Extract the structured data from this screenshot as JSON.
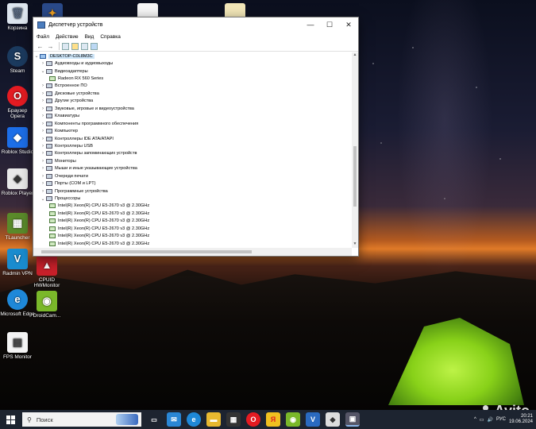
{
  "desktop": {
    "icons": [
      {
        "label": "Корзина",
        "icon": "recycle-bin-icon"
      },
      {
        "label": "Steam",
        "icon": "steam-icon"
      },
      {
        "label": "Браузер Opera",
        "icon": "opera-icon"
      },
      {
        "label": "Roblox Studio",
        "icon": "roblox-studio-icon"
      },
      {
        "label": "Roblox Player",
        "icon": "roblox-player-icon"
      },
      {
        "label": "TLauncher",
        "icon": "tlauncher-icon"
      },
      {
        "label": "Radmin VPN",
        "icon": "radmin-vpn-icon"
      },
      {
        "label": "Microsoft Edge",
        "icon": "edge-icon"
      },
      {
        "label": "FPS Monitor",
        "icon": "fps-monitor-icon"
      },
      {
        "label": "CPUID HWMonitor",
        "icon": "hwmonitor-icon"
      },
      {
        "label": "DroidCam...",
        "icon": "droidcam-icon"
      }
    ]
  },
  "window": {
    "title": "Диспетчер устройств",
    "controls": {
      "minimize": "—",
      "maximize": "☐",
      "close": "✕"
    },
    "menu": [
      "Файл",
      "Действие",
      "Вид",
      "Справка"
    ],
    "tree": {
      "root": "DESKTOP-C0L8M3C",
      "nodes": [
        {
          "label": "Аудиовходы и аудиовыходы",
          "expanded": false
        },
        {
          "label": "Видеоадаптеры",
          "expanded": true
        },
        {
          "label": "Radeon RX 560 Series",
          "child": true
        },
        {
          "label": "Встроенное ПО",
          "expanded": false
        },
        {
          "label": "Дисковые устройства",
          "expanded": false
        },
        {
          "label": "Другие устройства",
          "expanded": false
        },
        {
          "label": "Звуковые, игровые и видеоустройства",
          "expanded": false
        },
        {
          "label": "Клавиатуры",
          "expanded": false
        },
        {
          "label": "Компоненты программного обеспечения",
          "expanded": false
        },
        {
          "label": "Компьютер",
          "expanded": false
        },
        {
          "label": "Контроллеры IDE ATA/ATAPI",
          "expanded": false
        },
        {
          "label": "Контроллеры USB",
          "expanded": false
        },
        {
          "label": "Контроллеры запоминающих устройств",
          "expanded": false
        },
        {
          "label": "Мониторы",
          "expanded": false
        },
        {
          "label": "Мыши и иные указывающие устройства",
          "expanded": false
        },
        {
          "label": "Очереди печати",
          "expanded": false
        },
        {
          "label": "Порты (COM и LPT)",
          "expanded": false
        },
        {
          "label": "Программные устройства",
          "expanded": false
        },
        {
          "label": "Процессоры",
          "expanded": true
        },
        {
          "label": "Intel(R) Xeon(R) CPU E5-2670 v3 @ 2.30GHz",
          "child": true
        },
        {
          "label": "Intel(R) Xeon(R) CPU E5-2670 v3 @ 2.30GHz",
          "child": true
        },
        {
          "label": "Intel(R) Xeon(R) CPU E5-2670 v3 @ 2.30GHz",
          "child": true
        },
        {
          "label": "Intel(R) Xeon(R) CPU E5-2670 v3 @ 2.30GHz",
          "child": true
        },
        {
          "label": "Intel(R) Xeon(R) CPU E5-2670 v3 @ 2.30GHz",
          "child": true
        },
        {
          "label": "Intel(R) Xeon(R) CPU E5-2670 v3 @ 2.30GHz",
          "child": true
        }
      ]
    }
  },
  "taskbar": {
    "search_placeholder": "Поиск",
    "language": "РУС",
    "time": "20:21",
    "date": "19.06.2024"
  },
  "watermark": "Avito",
  "colors": {
    "taskbar": "#1d2430",
    "selection": "#cce4f7",
    "window_bg": "#ffffff"
  }
}
